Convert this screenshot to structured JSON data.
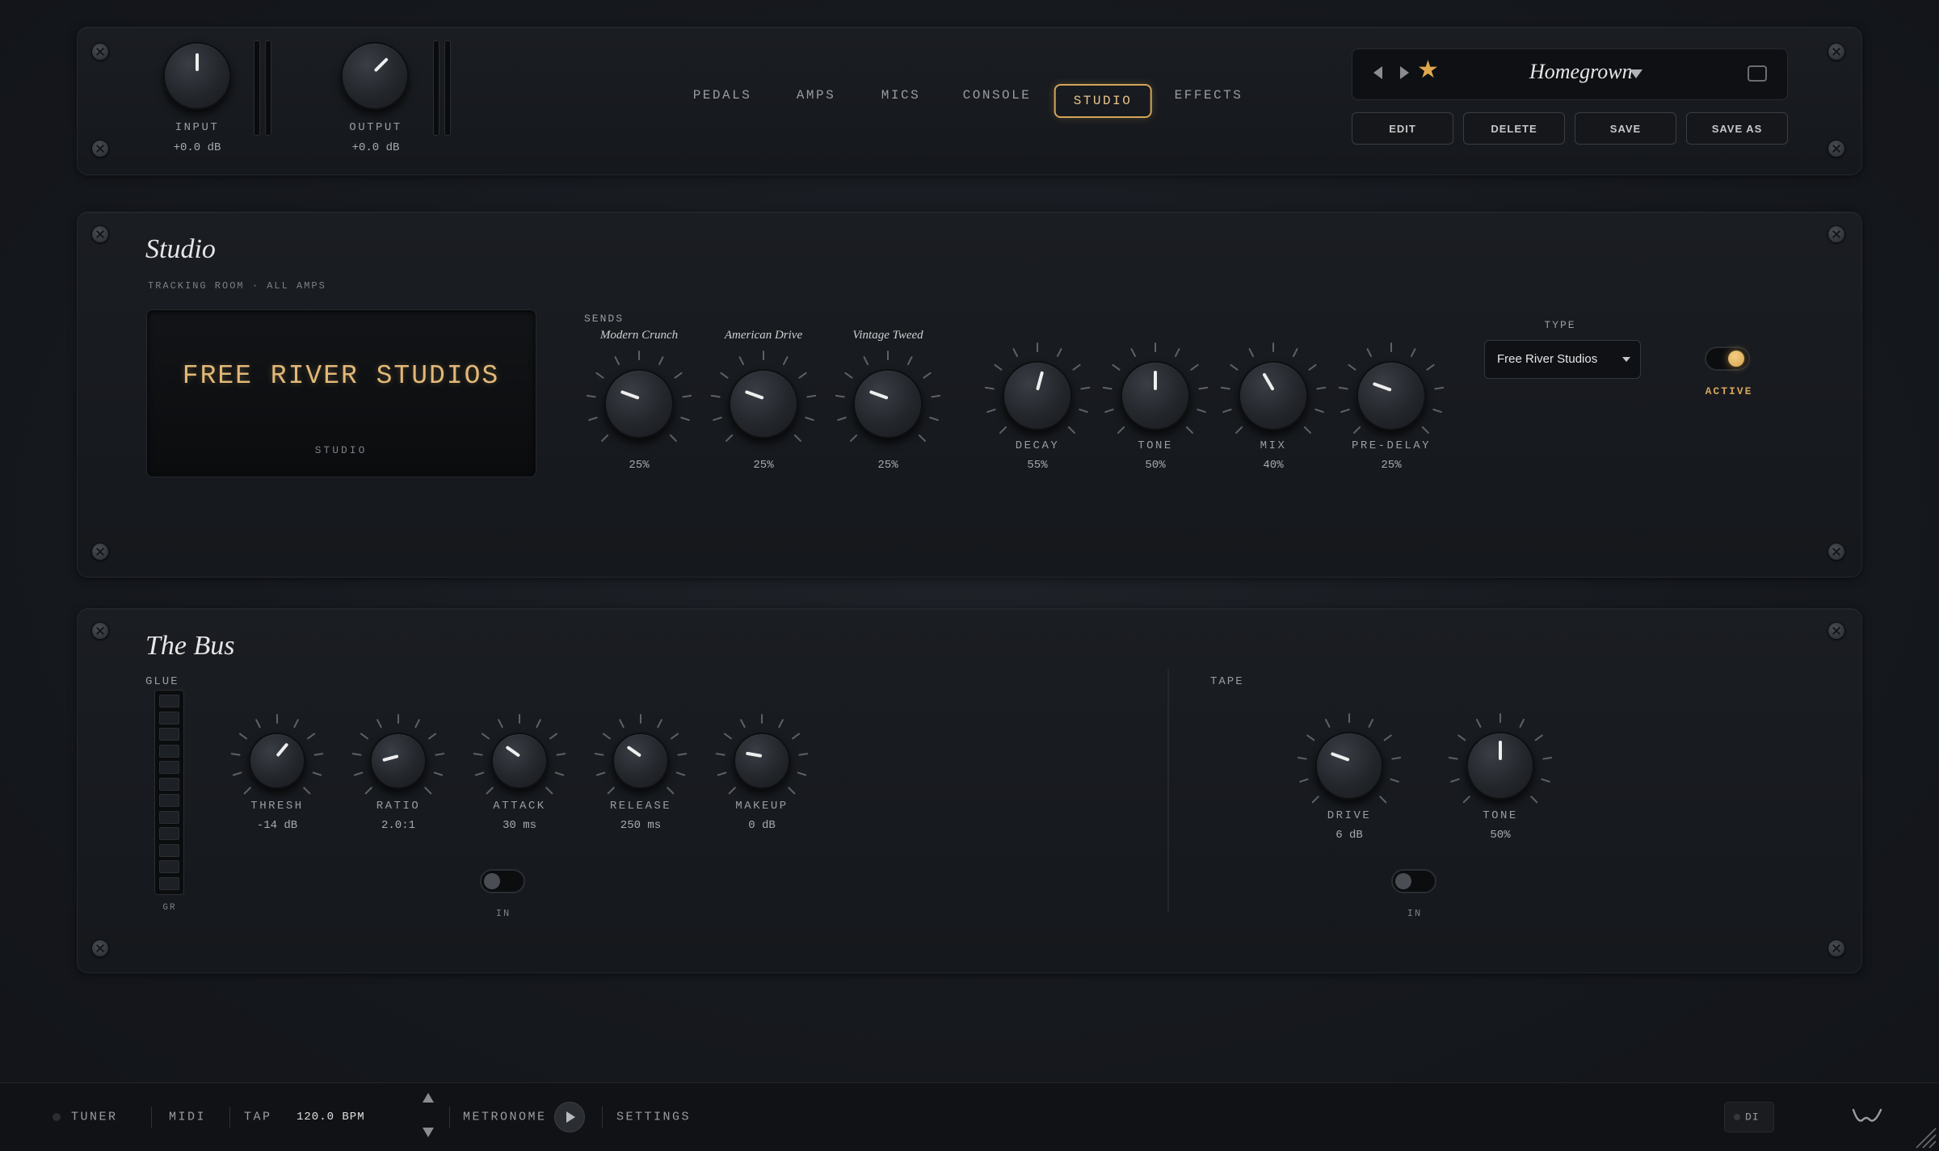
{
  "header": {
    "input": {
      "label": "INPUT",
      "value": "+0.0 dB"
    },
    "output": {
      "label": "OUTPUT",
      "value": "+0.0 dB"
    },
    "nav": [
      {
        "label": "PEDALS",
        "active": false
      },
      {
        "label": "AMPS",
        "active": false
      },
      {
        "label": "MICS",
        "active": false
      },
      {
        "label": "CONSOLE",
        "active": false
      },
      {
        "label": "STUDIO",
        "active": true
      },
      {
        "label": "EFFECTS",
        "active": false
      }
    ],
    "preset": {
      "name": "Homegrown",
      "favorite": true
    },
    "buttons": {
      "edit": "EDIT",
      "delete": "DELETE",
      "save": "SAVE",
      "save_as": "SAVE AS"
    }
  },
  "studio": {
    "title": "Studio",
    "subtitle": "TRACKING ROOM · ALL AMPS",
    "display_name": "FREE RIVER STUDIOS",
    "display_sub": "STUDIO",
    "sends_label": "SENDS",
    "sends": [
      {
        "name": "Modern Crunch",
        "value": "25%"
      },
      {
        "name": "American Drive",
        "value": "25%"
      },
      {
        "name": "Vintage Tweed",
        "value": "25%"
      }
    ],
    "controls": [
      {
        "label": "DECAY",
        "value": "55%"
      },
      {
        "label": "TONE",
        "value": "50%"
      },
      {
        "label": "MIX",
        "value": "40%"
      },
      {
        "label": "PRE-DELAY",
        "value": "25%"
      }
    ],
    "type_label": "TYPE",
    "type_value": "Free River Studios",
    "active_label": "ACTIVE",
    "active": true
  },
  "bus": {
    "title": "The Bus",
    "glue_label": "GLUE",
    "gr_label": "GR",
    "glue_controls": [
      {
        "label": "THRESH",
        "value": "-14 dB"
      },
      {
        "label": "RATIO",
        "value": "2.0:1"
      },
      {
        "label": "ATTACK",
        "value": "30 ms"
      },
      {
        "label": "RELEASE",
        "value": "250 ms"
      },
      {
        "label": "MAKEUP",
        "value": "0 dB"
      }
    ],
    "glue_in_label": "IN",
    "glue_in": false,
    "tape_label": "TAPE",
    "tape_controls": [
      {
        "label": "DRIVE",
        "value": "6 dB"
      },
      {
        "label": "TONE",
        "value": "50%"
      }
    ],
    "tape_in_label": "IN",
    "tape_in": false
  },
  "footer": {
    "tuner": "TUNER",
    "midi": "MIDI",
    "tap": "TAP",
    "bpm": "120.0 BPM",
    "metronome": "METRONOME",
    "settings": "SETTINGS",
    "di": "DI"
  },
  "colors": {
    "accent": "#d4a55a",
    "display_text": "#e2b877"
  }
}
